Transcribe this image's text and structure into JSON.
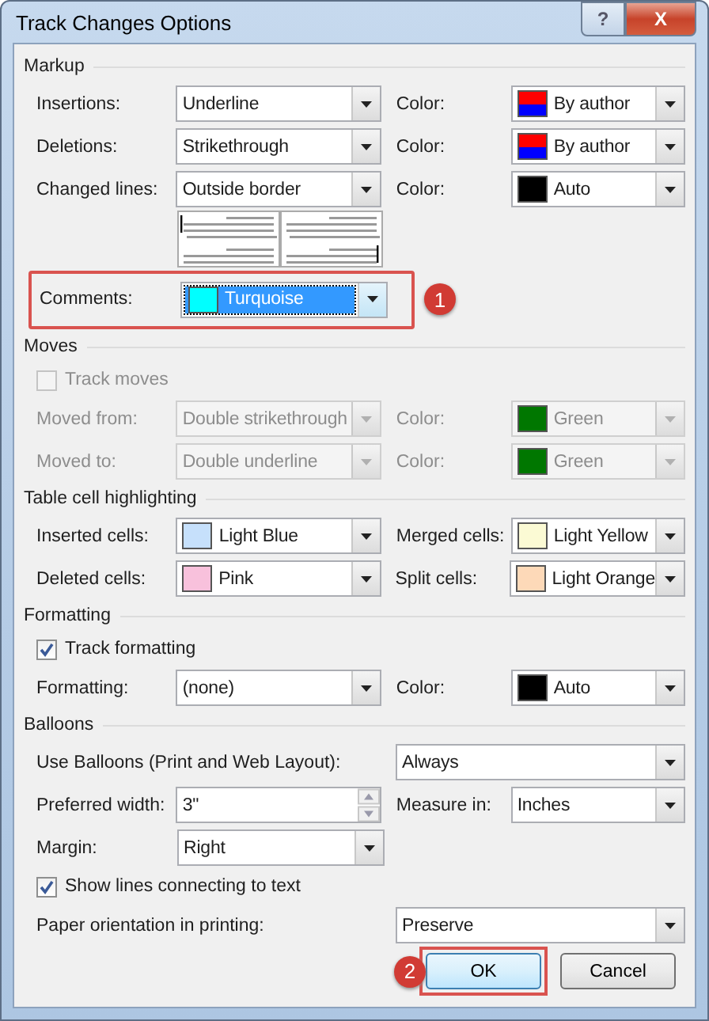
{
  "window": {
    "title": "Track Changes Options",
    "buttons": [
      {
        "kind": "help",
        "label": "?"
      },
      {
        "kind": "close",
        "label": "X"
      }
    ]
  },
  "sections": [
    {
      "title": "Markup",
      "rows": [
        {
          "kind": "pair",
          "left": {
            "label": "Insertions:",
            "field": {
              "kind": "dropdown",
              "value": "Underline"
            }
          },
          "right": {
            "label": "Color:",
            "field": {
              "kind": "dropdown",
              "value": "By author",
              "swatch": [
                {
                  "color": "#ff0000"
                },
                {
                  "color": "#0000ff"
                }
              ]
            }
          }
        },
        {
          "kind": "pair",
          "left": {
            "label": "Deletions:",
            "field": {
              "kind": "dropdown",
              "value": "Strikethrough"
            }
          },
          "right": {
            "label": "Color:",
            "field": {
              "kind": "dropdown",
              "value": "By author",
              "swatch": [
                {
                  "color": "#ff0000"
                },
                {
                  "color": "#0000ff"
                }
              ]
            }
          }
        },
        {
          "kind": "pair",
          "left": {
            "label": "Changed lines:",
            "field": {
              "kind": "dropdown",
              "value": "Outside border"
            }
          },
          "right": {
            "label": "Color:",
            "field": {
              "kind": "dropdown",
              "value": "Auto",
              "swatch": [
                {
                  "color": "#000000"
                }
              ]
            }
          }
        },
        {
          "kind": "preview"
        },
        {
          "kind": "pair",
          "callout": "1",
          "left": {
            "label": "Comments:",
            "field": {
              "kind": "dropdown",
              "value": "Turquoise",
              "swatch": [
                {
                  "color": "#00ffff"
                }
              ],
              "selected": true
            }
          }
        }
      ]
    },
    {
      "title": "Moves",
      "rows": [
        {
          "kind": "checkbox",
          "label": "Track moves",
          "checked": false,
          "disabled": true
        },
        {
          "kind": "pair",
          "disabled": true,
          "left": {
            "label": "Moved from:",
            "field": {
              "kind": "dropdown",
              "value": "Double strikethrough"
            }
          },
          "right": {
            "label": "Color:",
            "field": {
              "kind": "dropdown",
              "value": "Green",
              "swatch": [
                {
                  "color": "#007700"
                }
              ]
            }
          }
        },
        {
          "kind": "pair",
          "disabled": true,
          "left": {
            "label": "Moved to:",
            "field": {
              "kind": "dropdown",
              "value": "Double underline"
            }
          },
          "right": {
            "label": "Color:",
            "field": {
              "kind": "dropdown",
              "value": "Green",
              "swatch": [
                {
                  "color": "#007700"
                }
              ]
            }
          }
        }
      ]
    },
    {
      "title": "Table cell highlighting",
      "rows": [
        {
          "kind": "pair",
          "left": {
            "label": "Inserted cells:",
            "field": {
              "kind": "dropdown",
              "value": "Light Blue",
              "swatch": [
                {
                  "color": "#c6e0fb"
                }
              ]
            }
          },
          "right": {
            "label": "Merged cells:",
            "field": {
              "kind": "dropdown",
              "value": "Light Yellow",
              "swatch": [
                {
                  "color": "#fbfad4"
                }
              ]
            }
          }
        },
        {
          "kind": "pair",
          "left": {
            "label": "Deleted cells:",
            "field": {
              "kind": "dropdown",
              "value": "Pink",
              "swatch": [
                {
                  "color": "#f8c1dc"
                }
              ]
            }
          },
          "right": {
            "label": "Split cells:",
            "field": {
              "kind": "dropdown",
              "value": "Light Orange",
              "swatch": [
                {
                  "color": "#fdd9b8"
                }
              ]
            }
          }
        }
      ]
    },
    {
      "title": "Formatting",
      "rows": [
        {
          "kind": "checkbox",
          "label": "Track formatting",
          "checked": true,
          "disabled": false
        },
        {
          "kind": "pair",
          "left": {
            "label": "Formatting:",
            "field": {
              "kind": "dropdown",
              "value": "(none)"
            }
          },
          "right": {
            "label": "Color:",
            "field": {
              "kind": "dropdown",
              "value": "Auto",
              "swatch": [
                {
                  "color": "#000000"
                }
              ]
            }
          }
        }
      ]
    },
    {
      "title": "Balloons",
      "rows": [
        {
          "kind": "wide",
          "label": "Use Balloons (Print and Web Layout):",
          "field": {
            "kind": "dropdown",
            "value": "Always"
          }
        },
        {
          "kind": "pair",
          "left": {
            "label": "Preferred width:",
            "field": {
              "kind": "spin",
              "value": "3\""
            }
          },
          "right": {
            "label": "Measure in:",
            "field": {
              "kind": "dropdown",
              "value": "Inches"
            }
          }
        },
        {
          "kind": "pair",
          "left": {
            "label": "Margin:",
            "field": {
              "kind": "dropdown",
              "value": "Right"
            }
          }
        },
        {
          "kind": "checkbox",
          "label": "Show lines connecting to text",
          "checked": true,
          "disabled": false
        },
        {
          "kind": "wide",
          "label": "Paper orientation in printing:",
          "field": {
            "kind": "dropdown",
            "value": "Preserve"
          }
        }
      ]
    }
  ],
  "buttons": [
    {
      "label": "OK",
      "callout": "2"
    },
    {
      "label": "Cancel"
    }
  ]
}
